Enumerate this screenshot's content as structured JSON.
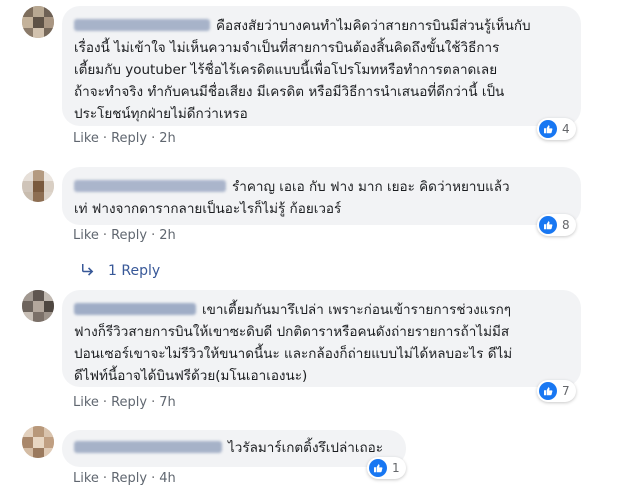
{
  "comments": [
    {
      "text": "คือสงสัยว่าบางคนทำไมคิดว่าสายการบินมีส่วนรู้เห็นกับ\nเรื่องนี้ ไม่เข้าใจ ไม่เห็นความจำเป็นที่สายการบินต้องสิ้นคิดถึงขั้นใช้วิธีการ\nเตี้ยมกับ youtuber ไร้ชื่อไร้เครดิตแบบนี้เพื่อโปรโมทหรือทำการตลาดเลย\nถ้าจะทำจริง ทำกับคนมีชื่อเสียง มีเครดิต หรือมีวิธีการนำเสนอที่ดีกว่านี้ เป็น\nประโยชน์ทุกฝ่ายไม่ดีกว่าเหรอ",
      "like_label": "Like",
      "reply_label": "Reply",
      "time": "2h",
      "reaction_count": "4"
    },
    {
      "text": "รำคาญ เอเอ กับ ฟาง มาก เยอะ คิดว่าหยาบแล้ว\nเท่ ฟางจากดารากลายเป็นอะไรก็ไม่รู้ ก้อยเวอร์",
      "like_label": "Like",
      "reply_label": "Reply",
      "time": "2h",
      "reaction_count": "8",
      "replies_label": "1 Reply"
    },
    {
      "text": "เขาเตี้ยมกันมารึเปล่า เพราะก่อนเข้ารายการช่วงแรกๆ\nฟางก็รีวิวสายการบินให้เขาซะดิบดี ปกติดาราหรือคนดังถ่ายรายการถ้าไม่มีส\nปอนเซอร์เขาจะไม่รีวิวให้ขนาดนี้นะ และกล้องก็ถ่ายแบบไม่ได้หลบอะไร ดีไม่\nดีไฟท์นี้อาจได้บินฟรีด้วย(มโนเอาเองนะ)",
      "like_label": "Like",
      "reply_label": "Reply",
      "time": "7h",
      "reaction_count": "7"
    },
    {
      "text": "ไวรัลมาร์เกตติ้งรึเปล่าเถอะ",
      "like_label": "Like",
      "reply_label": "Reply",
      "time": "4h",
      "reaction_count": "1"
    }
  ],
  "colors": {
    "bubble": "#f2f3f5",
    "link": "#385898",
    "like_blue": "#1877f2",
    "meta": "#65676b"
  },
  "icons": {
    "reaction": "thumbs-up-icon",
    "reply_arrow": "reply-arrow-icon"
  }
}
